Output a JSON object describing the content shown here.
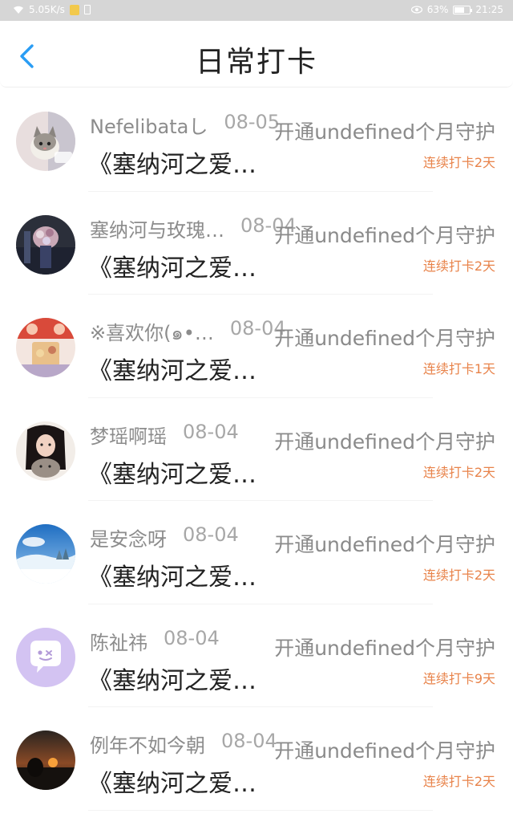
{
  "status_bar": {
    "speed": "5.05K/s",
    "battery_percent": "63%",
    "battery_level": 0.63,
    "time": "21:25"
  },
  "header": {
    "title": "日常打卡",
    "back_icon": "chevron-left-icon",
    "accent_color": "#2a9df4"
  },
  "checkins": [
    {
      "name": "Nefelibataし",
      "date": "08-05",
      "song": "《塞纳河之爱…",
      "guard": "开通undefined个月守护",
      "streak": "连续打卡2天",
      "avatar": "cat"
    },
    {
      "name": "塞纳河与玫瑰…",
      "date": "08-04",
      "song": "《塞纳河之爱…",
      "guard": "开通undefined个月守护",
      "streak": "连续打卡2天",
      "avatar": "bouquet"
    },
    {
      "name": "※喜欢你(๑•…",
      "date": "08-04",
      "song": "《塞纳河之爱…",
      "guard": "开通undefined个月守护",
      "streak": "连续打卡1天",
      "avatar": "party"
    },
    {
      "name": "梦瑶啊瑶",
      "date": "08-04",
      "song": "《塞纳河之爱…",
      "guard": "开通undefined个月守护",
      "streak": "连续打卡2天",
      "avatar": "girl-cat"
    },
    {
      "name": "是安念呀",
      "date": "08-04",
      "song": "《塞纳河之爱…",
      "guard": "开通undefined个月守护",
      "streak": "连续打卡2天",
      "avatar": "snow"
    },
    {
      "name": "陈祉祎",
      "date": "08-04",
      "song": "《塞纳河之爱…",
      "guard": "开通undefined个月守护",
      "streak": "连续打卡9天",
      "avatar": "chat-bubble"
    },
    {
      "name": "例年不如今朝",
      "date": "08-04",
      "song": "《塞纳河之爱…",
      "guard": "开通undefined个月守护",
      "streak": "连续打卡2天",
      "avatar": "sunset"
    }
  ]
}
